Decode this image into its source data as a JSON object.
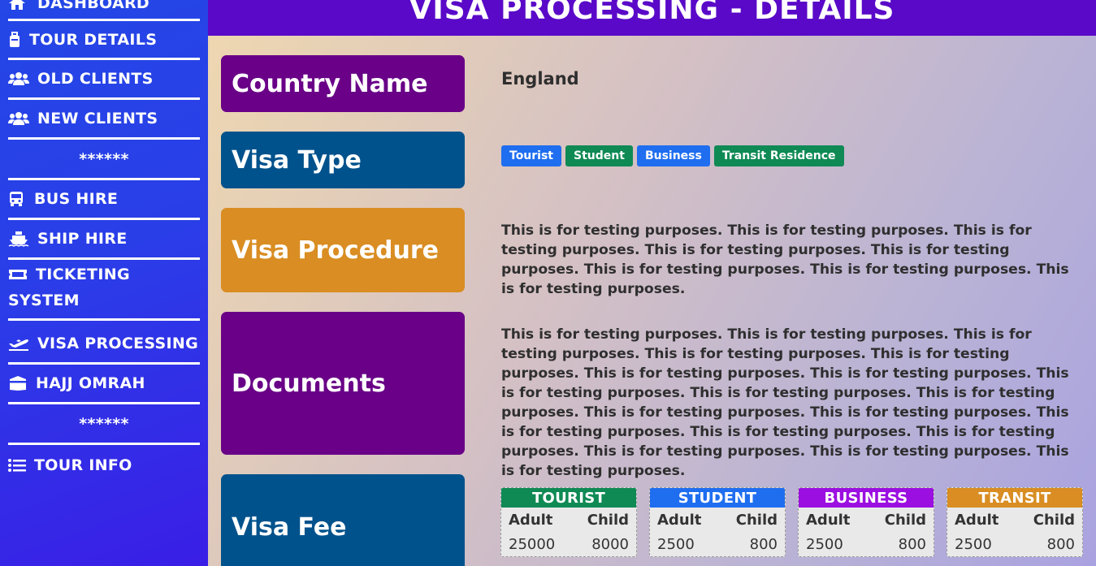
{
  "sidebar": {
    "items": [
      {
        "label": "DASHBOARD",
        "icon": "home-icon"
      },
      {
        "label": "TOUR DETAILS",
        "icon": "suitcase-icon"
      },
      {
        "label": "OLD CLIENTS",
        "icon": "users-icon"
      },
      {
        "label": "NEW CLIENTS",
        "icon": "users-icon"
      },
      {
        "label": "******"
      },
      {
        "label": "BUS HIRE",
        "icon": "bus-icon"
      },
      {
        "label": "SHIP HIRE",
        "icon": "ship-icon"
      },
      {
        "label_line1": "TICKETING",
        "label_line2": "SYSTEM",
        "icon": "ticket-icon"
      },
      {
        "label": "VISA PROCESSING",
        "icon": "plane-departure-icon"
      },
      {
        "label": "HAJJ OMRAH",
        "icon": "kaaba-icon"
      },
      {
        "label": "******"
      },
      {
        "label": "TOUR INFO",
        "icon": "list-icon"
      }
    ]
  },
  "header": {
    "title": "VISA PROCESSING - DETAILS"
  },
  "details": {
    "country": {
      "label": "Country Name",
      "value": "England"
    },
    "visa_type": {
      "label": "Visa Type",
      "badges": [
        {
          "text": "Tourist",
          "color": "#1f6ef0"
        },
        {
          "text": "Student",
          "color": "#0f8a55"
        },
        {
          "text": "Business",
          "color": "#1f6ef0"
        },
        {
          "text": "Transit Residence",
          "color": "#0f8a55"
        }
      ]
    },
    "procedure": {
      "label": "Visa Procedure",
      "text": "This is for testing purposes. This is for testing purposes. This is for testing purposes. This is for testing purposes. This is for testing purposes. This is for testing purposes. This is for testing purposes. This is for testing purposes."
    },
    "documents": {
      "label": "Documents",
      "text": "This is for testing purposes. This is for testing purposes. This is for testing purposes. This is for testing purposes. This is for testing purposes. This is for testing purposes. This is for testing purposes. This is for testing purposes. This is for testing purposes. This is for testing purposes. This is for testing purposes. This is for testing purposes. This is for testing purposes. This is for testing purposes. This is for testing purposes. This is for testing purposes. This is for testing purposes. This is for testing purposes."
    },
    "fee": {
      "label": "Visa Fee",
      "cards": [
        {
          "title": "TOURIST",
          "color": "#0f8a55",
          "adult_label": "Adult",
          "child_label": "Child",
          "adult": "25000",
          "child": "8000"
        },
        {
          "title": "STUDENT",
          "color": "#1f6ef0",
          "adult_label": "Adult",
          "child_label": "Child",
          "adult": "2500",
          "child": "800"
        },
        {
          "title": "BUSINESS",
          "color": "#9b0fe0",
          "adult_label": "Adult",
          "child_label": "Child",
          "adult": "2500",
          "child": "800"
        },
        {
          "title": "TRANSIT",
          "color": "#d98d22",
          "adult_label": "Adult",
          "child_label": "Child",
          "adult": "2500",
          "child": "800"
        }
      ]
    }
  },
  "colors": {
    "label_purple": "#690087",
    "label_blue": "#00528c",
    "label_orange": "#d98d22",
    "header_bg": "#5a09c8"
  }
}
